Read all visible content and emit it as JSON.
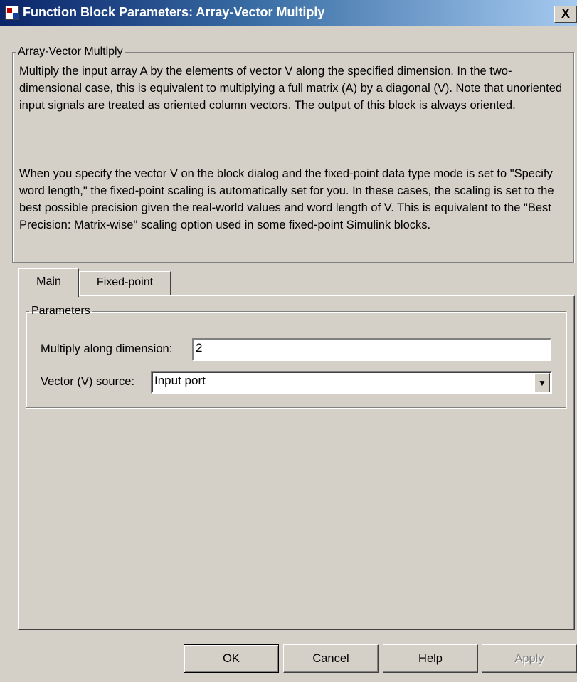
{
  "window": {
    "title": "Function Block Parameters: Array-Vector Multiply",
    "close_glyph": "X",
    "icon": "simulink-block-icon"
  },
  "description_group": {
    "legend": "Array-Vector Multiply",
    "paragraph1": "Multiply the input array A by the elements of vector V along the specified dimension.  In the two-dimensional case, this is equivalent to multiplying a full matrix (A) by a diagonal (V). Note that unoriented input signals are treated as oriented column vectors. The output of this block is always oriented.",
    "paragraph2": "When you specify the vector V on the block dialog and the fixed-point data type mode is set to \"Specify word length,\" the fixed-point scaling is automatically set for you. In these cases, the scaling is set to the best possible precision given the real-world values and word length of V. This is equivalent to the \"Best Precision: Matrix-wise\" scaling option used in some fixed-point Simulink blocks."
  },
  "tabs": [
    {
      "label": "Main",
      "active": true
    },
    {
      "label": "Fixed-point",
      "active": false
    }
  ],
  "parameters": {
    "legend": "Parameters",
    "multiply_dim_label": "Multiply along dimension:",
    "multiply_dim_value": "2",
    "vector_source_label": "Vector (V) source:",
    "vector_source_value": "Input port"
  },
  "buttons": {
    "ok": "OK",
    "cancel": "Cancel",
    "help": "Help",
    "apply": "Apply"
  },
  "colors": {
    "dialog_bg": "#d4d0c8",
    "title_gradient_start": "#0a246a",
    "title_gradient_end": "#a6caf0"
  }
}
